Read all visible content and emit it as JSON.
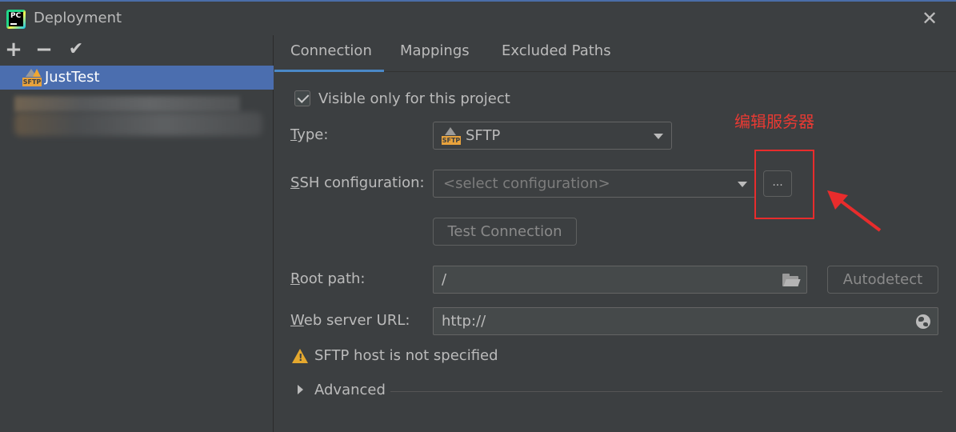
{
  "window": {
    "title": "Deployment",
    "app_icon_text": "PC"
  },
  "toolbar": {
    "add": "+",
    "remove": "−",
    "apply": "✔"
  },
  "servers": [
    {
      "name": "JustTest",
      "icon_label": "SFTP"
    }
  ],
  "tabs": [
    {
      "label": "Connection",
      "active": true
    },
    {
      "label": "Mappings",
      "active": false
    },
    {
      "label": "Excluded Paths",
      "active": false
    }
  ],
  "connection": {
    "visible_only_label": "Visible only for this project",
    "type_label_mnemonic": "T",
    "type_label_rest": "ype:",
    "type_value": "SFTP",
    "type_icon_label": "SFTP",
    "ssh_label_mnemonic": "S",
    "ssh_label_rest": "SH configuration:",
    "ssh_placeholder": "<select configuration>",
    "ssh_browse_label": "...",
    "test_connection_label": "Test Connection",
    "root_label_mnemonic": "R",
    "root_label_rest": "oot path:",
    "root_value": "/",
    "autodetect_label": "Autodetect",
    "web_label_mnemonic": "W",
    "web_label_rest": "eb server URL:",
    "web_value": "http://",
    "warning_text": "SFTP host is not specified",
    "advanced_label": "Advanced"
  },
  "annotation": {
    "text": "编辑服务器",
    "color": "#e83a33"
  },
  "colors": {
    "background": "#3c3f41",
    "selection": "#4b6eaf",
    "tab_underline": "#4a88c7",
    "warning": "#e5a82e"
  }
}
